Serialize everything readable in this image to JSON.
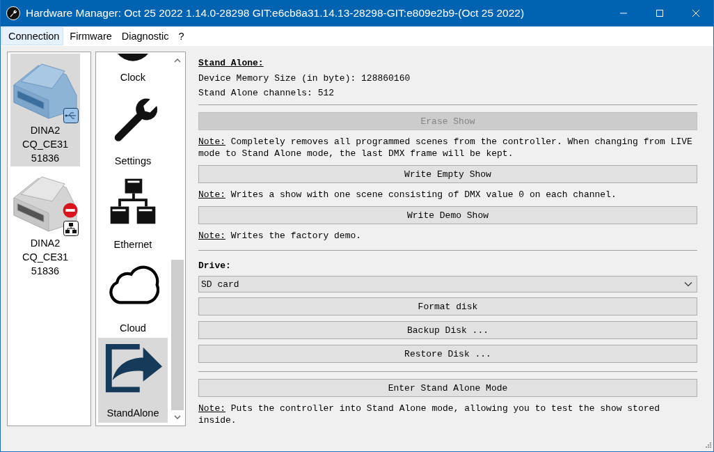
{
  "window": {
    "title": "Hardware Manager: Oct 25 2022 1.14.0-28298 GIT:e6cb8a31.14.13-28298-GIT:e809e2b9-(Oct 25 2022)"
  },
  "menu": [
    {
      "label": "Connection",
      "selected": true
    },
    {
      "label": "Firmware",
      "selected": false
    },
    {
      "label": "Diagnostic",
      "selected": false
    },
    {
      "label": "?",
      "selected": false
    }
  ],
  "devices": [
    {
      "lines": [
        "DINA2",
        "CQ_CE31",
        "51836"
      ],
      "selected": true,
      "kind": "usb",
      "error": false
    },
    {
      "lines": [
        "DINA2",
        "CQ_CE31",
        "51836"
      ],
      "selected": false,
      "kind": "ethernet",
      "error": true
    }
  ],
  "nav": [
    {
      "label": "Clock",
      "selected": false
    },
    {
      "label": "Settings",
      "selected": false
    },
    {
      "label": "Ethernet",
      "selected": false
    },
    {
      "label": "Cloud",
      "selected": false
    },
    {
      "label": "StandAlone",
      "selected": true
    }
  ],
  "content": [
    {
      "kind": "heading",
      "text": "Stand Alone:"
    },
    {
      "kind": "info",
      "text": "Device Memory Size (in byte): 128860160"
    },
    {
      "kind": "info",
      "text": "Stand Alone channels: 512"
    },
    {
      "kind": "separator"
    },
    {
      "kind": "button",
      "label": "Erase Show",
      "disabled": true
    },
    {
      "kind": "note",
      "label": "Note:",
      "text": "Completely removes all programmed scenes from the controller. When changing from LIVE mode to Stand Alone mode, the last DMX frame will be kept."
    },
    {
      "kind": "button",
      "label": "Write Empty Show",
      "disabled": false
    },
    {
      "kind": "note",
      "label": "Note:",
      "text": "Writes a show with one scene consisting of DMX value 0 on each channel."
    },
    {
      "kind": "button",
      "label": "Write Demo Show",
      "disabled": false
    },
    {
      "kind": "note",
      "label": "Note:",
      "text": "Writes the factory demo."
    },
    {
      "kind": "separator"
    },
    {
      "kind": "label",
      "text": "Drive:"
    },
    {
      "kind": "select",
      "value": "SD card"
    },
    {
      "kind": "button",
      "label": "Format disk",
      "disabled": false
    },
    {
      "kind": "button",
      "label": "Backup Disk ...",
      "disabled": false
    },
    {
      "kind": "button",
      "label": "Restore Disk ...",
      "disabled": false
    },
    {
      "kind": "separator"
    },
    {
      "kind": "button",
      "label": "Enter Stand Alone Mode",
      "disabled": false
    },
    {
      "kind": "note",
      "label": "Note:",
      "text": "Puts the controller into Stand Alone mode, allowing you to test the show stored inside."
    }
  ]
}
